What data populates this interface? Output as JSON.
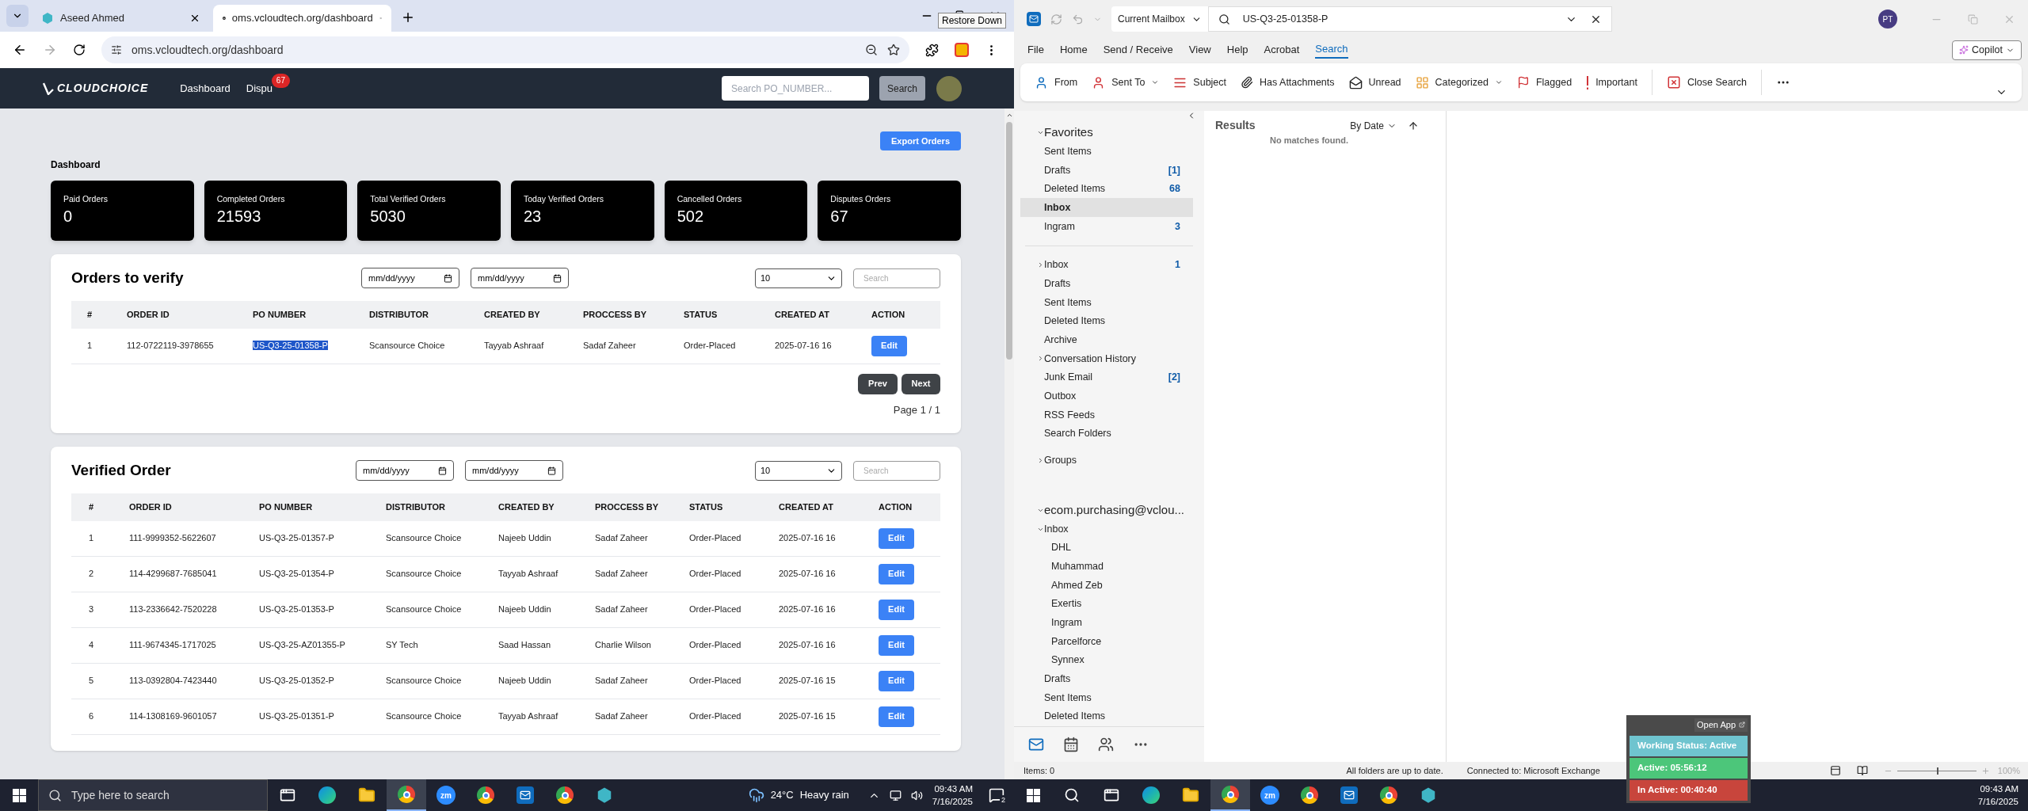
{
  "browser": {
    "tabs": [
      {
        "title": "Aseed Ahmed",
        "kind": "hexagon",
        "selected": false
      },
      {
        "title": "oms.vcloudtech.org/dashboard",
        "kind": "triangle",
        "selected": true
      }
    ],
    "url": "oms.vcloudtech.org/dashboard",
    "tooltip": "Restore Down"
  },
  "app": {
    "brand": "CLOUDCHOICE",
    "nav": [
      {
        "label": "Dashboard"
      },
      {
        "label": "Dispu",
        "badge": "67"
      }
    ],
    "search": {
      "placeholder": "Search PO_NUMBER...",
      "button": "Search"
    },
    "export_button": "Export Orders",
    "heading": "Dashboard",
    "stats": [
      {
        "label": "Paid Orders",
        "value": "0"
      },
      {
        "label": "Completed Orders",
        "value": "21593"
      },
      {
        "label": "Total Verified Orders",
        "value": "5030"
      },
      {
        "label": "Today Verified Orders",
        "value": "23"
      },
      {
        "label": "Cancelled Orders",
        "value": "502"
      },
      {
        "label": "Disputes Orders",
        "value": "67"
      }
    ],
    "orders_to_verify": {
      "title": "Orders to verify",
      "date_from": "mm/dd/yyyy",
      "date_to": "mm/dd/yyyy",
      "page_size": "10",
      "search_placeholder": "Search",
      "columns": [
        "#",
        "ORDER ID",
        "PO NUMBER",
        "DISTRIBUTOR",
        "CREATED BY",
        "PROCCESS BY",
        "STATUS",
        "CREATED AT",
        "ACTION"
      ],
      "rows": [
        {
          "number": "1",
          "order_id": "112-0722119-3978655",
          "po_number": "US-Q3-25-01358-P",
          "po_selected": true,
          "distributor": "Scansource Choice",
          "created_by": "Tayyab Ashraaf",
          "processed_by": "Sadaf Zaheer",
          "status": "Order-Placed",
          "created_at": "2025-07-16 16",
          "action": "Edit"
        }
      ],
      "pagination": {
        "prev": "Prev",
        "next": "Next",
        "page": "Page 1 / 1"
      }
    },
    "verified_orders": {
      "title": "Verified Order",
      "date_from": "mm/dd/yyyy",
      "date_to": "mm/dd/yyyy",
      "page_size": "10",
      "search_placeholder": "Search",
      "columns": [
        "#",
        "ORDER ID",
        "PO NUMBER",
        "DISTRIBUTOR",
        "CREATED BY",
        "PROCCESS BY",
        "STATUS",
        "CREATED AT",
        "ACTION"
      ],
      "rows": [
        {
          "number": "1",
          "order_id": "111-9999352-5622607",
          "po_number": "US-Q3-25-01357-P",
          "po_selected": false,
          "distributor": "Scansource Choice",
          "created_by": "Najeeb Uddin",
          "processed_by": "Sadaf Zaheer",
          "status": "Order-Placed",
          "created_at": "2025-07-16 16",
          "action": "Edit"
        },
        {
          "number": "2",
          "order_id": "114-4299687-7685041",
          "po_number": "US-Q3-25-01354-P",
          "po_selected": false,
          "distributor": "Scansource Choice",
          "created_by": "Tayyab Ashraaf",
          "processed_by": "Sadaf Zaheer",
          "status": "Order-Placed",
          "created_at": "2025-07-16 16",
          "action": "Edit"
        },
        {
          "number": "3",
          "order_id": "113-2336642-7520228",
          "po_number": "US-Q3-25-01353-P",
          "po_selected": false,
          "distributor": "Scansource Choice",
          "created_by": "Najeeb Uddin",
          "processed_by": "Sadaf Zaheer",
          "status": "Order-Placed",
          "created_at": "2025-07-16 16",
          "action": "Edit"
        },
        {
          "number": "4",
          "order_id": "111-9674345-1717025",
          "po_number": "US-Q3-25-AZ01355-P",
          "po_selected": false,
          "distributor": "SY Tech",
          "created_by": "Saad Hassan",
          "processed_by": "Charlie Wilson",
          "status": "Order-Placed",
          "created_at": "2025-07-16 16",
          "action": "Edit"
        },
        {
          "number": "5",
          "order_id": "113-0392804-7423440",
          "po_number": "US-Q3-25-01352-P",
          "po_selected": false,
          "distributor": "Scansource Choice",
          "created_by": "Najeeb Uddin",
          "processed_by": "Sadaf Zaheer",
          "status": "Order-Placed",
          "created_at": "2025-07-16 15",
          "action": "Edit"
        },
        {
          "number": "6",
          "order_id": "114-1308169-9601057",
          "po_number": "US-Q3-25-01351-P",
          "po_selected": false,
          "distributor": "Scansource Choice",
          "created_by": "Tayyab Ashraaf",
          "processed_by": "Sadaf Zaheer",
          "status": "Order-Placed",
          "created_at": "2025-07-16 15",
          "action": "Edit"
        }
      ]
    }
  },
  "outlook": {
    "scope": "Current Mailbox",
    "search_value": "US-Q3-25-01358-P",
    "avatar": "PT",
    "menu": [
      {
        "label": "File",
        "selected": false
      },
      {
        "label": "Home",
        "selected": false
      },
      {
        "label": "Send / Receive",
        "selected": false
      },
      {
        "label": "View",
        "selected": false
      },
      {
        "label": "Help",
        "selected": false
      },
      {
        "label": "Acrobat",
        "selected": false
      },
      {
        "label": "Search",
        "selected": true
      }
    ],
    "copilot": "Copilot",
    "ribbon": [
      {
        "label": "From",
        "kind": "from",
        "dropdown": false
      },
      {
        "label": "Sent To",
        "kind": "sent_to",
        "dropdown": true
      },
      {
        "label": "Subject",
        "kind": "subject",
        "dropdown": false
      },
      {
        "label": "Has Attachments",
        "kind": "attachments",
        "dropdown": false
      },
      {
        "label": "Unread",
        "kind": "unread",
        "dropdown": false
      },
      {
        "label": "Categorized",
        "kind": "categorized",
        "dropdown": true
      },
      {
        "label": "Flagged",
        "kind": "flagged",
        "dropdown": false
      },
      {
        "label": "Important",
        "kind": "important",
        "dropdown": false
      },
      {
        "label": "Close Search",
        "kind": "close_search",
        "dropdown": false
      }
    ],
    "favorites": {
      "label": "Favorites",
      "expanded": true,
      "items": [
        {
          "label": "Sent Items",
          "selected": false
        },
        {
          "label": "Drafts",
          "count": "[1]",
          "selected": false
        },
        {
          "label": "Deleted Items",
          "count": "68",
          "selected": false
        },
        {
          "label": "Inbox",
          "selected": true
        },
        {
          "label": "Ingram",
          "count": "3",
          "selected": false
        }
      ]
    },
    "folders": [
      {
        "label": "Inbox",
        "count": "1",
        "expanded": false,
        "selected": false
      },
      {
        "label": "Drafts",
        "selected": false
      },
      {
        "label": "Sent Items",
        "selected": false
      },
      {
        "label": "Deleted Items",
        "selected": false
      },
      {
        "label": "Archive",
        "selected": false
      },
      {
        "label": "Conversation History",
        "expanded": false,
        "selected": false
      },
      {
        "label": "Junk Email",
        "count": "[2]",
        "selected": false
      },
      {
        "label": "Outbox",
        "selected": false
      },
      {
        "label": "RSS Feeds",
        "selected": false
      },
      {
        "label": "Search Folders",
        "selected": false
      }
    ],
    "groups": {
      "label": "Groups",
      "expanded": false
    },
    "account": {
      "label": "ecom.purchasing@vclou...",
      "expanded": true,
      "children": [
        {
          "label": "Inbox",
          "expanded": true,
          "selected": false,
          "children": [
            {
              "label": "DHL",
              "selected": false
            },
            {
              "label": "Muhammad",
              "selected": false
            },
            {
              "label": "Ahmed Zeb",
              "selected": false
            },
            {
              "label": "Exertis",
              "selected": false
            },
            {
              "label": "Ingram",
              "selected": false
            },
            {
              "label": "Parcelforce",
              "selected": false
            },
            {
              "label": "Synnex",
              "selected": false
            }
          ]
        },
        {
          "label": "Drafts",
          "selected": false
        },
        {
          "label": "Sent Items",
          "selected": false
        },
        {
          "label": "Deleted Items",
          "selected": false
        }
      ]
    },
    "nav_icons": [
      {
        "kind": "mail",
        "selected": true
      },
      {
        "kind": "calendar",
        "selected": false
      },
      {
        "kind": "people",
        "selected": false
      },
      {
        "kind": "more",
        "selected": false
      }
    ],
    "results": {
      "title": "Results",
      "sort": "By Date",
      "empty": "No matches found."
    },
    "status": {
      "items": "Items: 0",
      "sync": "All folders are up to date.",
      "connection": "Connected to: Microsoft Exchange",
      "zoom": "100%",
      "level": 0.5
    }
  },
  "tracker": {
    "open_app": "Open App",
    "statuses": [
      {
        "label": "Working Status: Active",
        "color": "#6fc4cf"
      },
      {
        "label": "Active: 05:56:12",
        "color": "#4cc67a"
      },
      {
        "label": "In Active: 00:40:40",
        "color": "#c8453c"
      }
    ]
  },
  "taskbars": [
    {
      "search_placeholder": "Type here to search",
      "apps": [
        {
          "kind": "taskview",
          "active": false
        },
        {
          "kind": "edge",
          "active": false
        },
        {
          "kind": "folder",
          "active": false
        },
        {
          "kind": "chrome",
          "active": true
        },
        {
          "kind": "zoom",
          "label": "zm",
          "active": false
        },
        {
          "kind": "chrome",
          "active": false
        },
        {
          "kind": "outlook",
          "active": false
        },
        {
          "kind": "chrome",
          "active": false
        },
        {
          "kind": "hexagon",
          "active": false
        }
      ],
      "weather": {
        "temp": "24°C",
        "text": "Heavy rain"
      },
      "time": "09:43 AM",
      "date": "7/16/2025",
      "notifications": "2"
    },
    {
      "apps": [
        {
          "kind": "taskview",
          "active": false
        },
        {
          "kind": "edge",
          "active": false
        },
        {
          "kind": "folder",
          "active": false
        },
        {
          "kind": "chrome",
          "active": true
        },
        {
          "kind": "zoom",
          "label": "zm",
          "active": false
        },
        {
          "kind": "chrome",
          "active": false
        },
        {
          "kind": "outlook",
          "active": false
        },
        {
          "kind": "chrome",
          "active": false
        },
        {
          "kind": "hexagon",
          "active": false
        }
      ],
      "time": "09:43 AM",
      "date": "7/16/2025"
    }
  ]
}
